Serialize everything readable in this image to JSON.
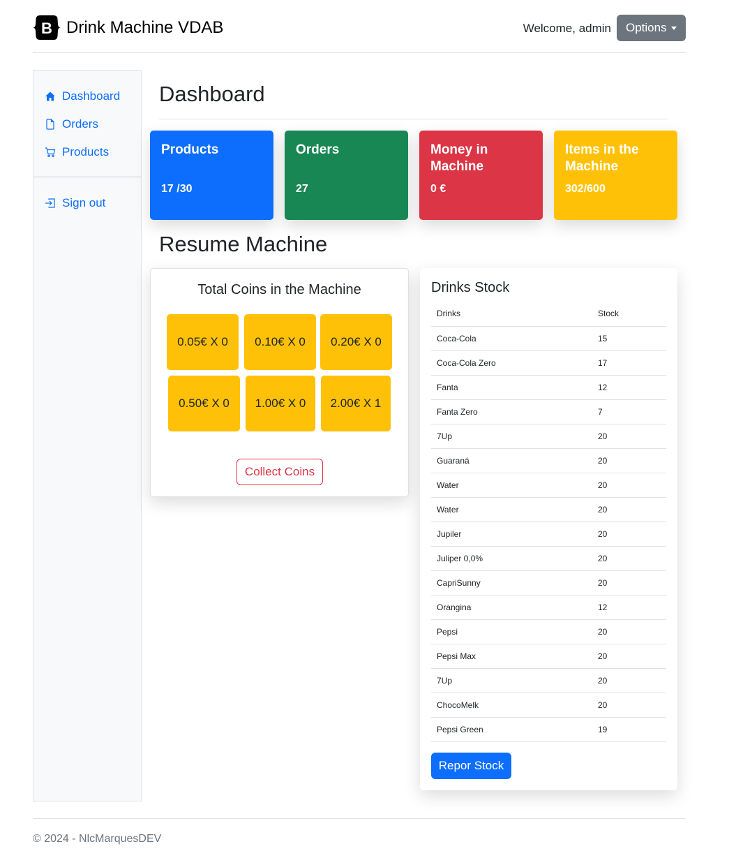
{
  "header": {
    "logo_letter": "B",
    "brand": "Drink Machine VDAB",
    "welcome": "Welcome, admin",
    "options_label": "Options"
  },
  "sidebar": {
    "items": [
      {
        "label": "Dashboard",
        "icon": "house-icon"
      },
      {
        "label": "Orders",
        "icon": "file-icon"
      },
      {
        "label": "Products",
        "icon": "cart-icon"
      }
    ],
    "signout": {
      "label": "Sign out",
      "icon": "sign-in-icon"
    }
  },
  "main": {
    "title": "Dashboard",
    "stats": [
      {
        "title": "Products",
        "value": "17 /30",
        "color": "#0d6efd"
      },
      {
        "title": "Orders",
        "value": "27",
        "color": "#198754"
      },
      {
        "title": "Money in Machine",
        "value": "0 €",
        "color": "#dc3545"
      },
      {
        "title": "Items in the Machine",
        "value": "302/600",
        "color": "#ffc107"
      }
    ],
    "section_title": "Resume Machine"
  },
  "coins": {
    "title": "Total Coins in the Machine",
    "items": [
      "0.05€ X 0",
      "0.10€ X 0",
      "0.20€ X 0",
      "0.50€ X 0",
      "1.00€ X 0",
      "2.00€ X 1"
    ],
    "collect_label": "Collect Coins"
  },
  "stock": {
    "title": "Drinks Stock",
    "headers": [
      "Drinks",
      "Stock"
    ],
    "rows": [
      [
        "Coca-Cola",
        "15"
      ],
      [
        "Coca-Cola Zero",
        "17"
      ],
      [
        "Fanta",
        "12"
      ],
      [
        "Fanta Zero",
        "7"
      ],
      [
        "7Up",
        "20"
      ],
      [
        "Guaraná",
        "20"
      ],
      [
        "Water",
        "20"
      ],
      [
        "Water",
        "20"
      ],
      [
        "Jupiler",
        "20"
      ],
      [
        "Juliper 0,0%",
        "20"
      ],
      [
        "CapriSunny",
        "20"
      ],
      [
        "Orangina",
        "12"
      ],
      [
        "Pepsi",
        "20"
      ],
      [
        "Pepsi Max",
        "20"
      ],
      [
        "7Up",
        "20"
      ],
      [
        "ChocoMelk",
        "20"
      ],
      [
        "Pepsi Green",
        "19"
      ]
    ],
    "button_label": "Repor Stock"
  },
  "footer": {
    "text": "© 2024 - NlcMarquesDEV"
  }
}
